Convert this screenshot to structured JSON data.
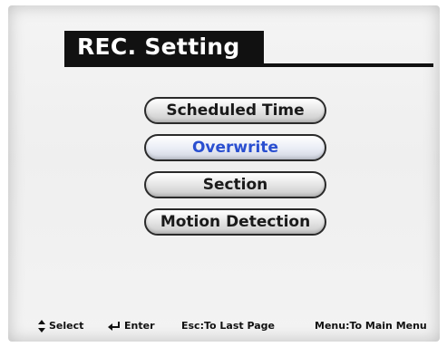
{
  "header": {
    "title": "REC. Setting"
  },
  "menu": {
    "items": [
      {
        "label": "Scheduled Time"
      },
      {
        "label": "Overwrite"
      },
      {
        "label": "Section"
      },
      {
        "label": "Motion Detection"
      }
    ],
    "selected_index": 1
  },
  "footer": {
    "select": {
      "icon": "up-down-arrows-icon",
      "label": "Select"
    },
    "enter": {
      "icon": "enter-return-icon",
      "label": "Enter"
    },
    "esc": {
      "label": "Esc:To Last Page"
    },
    "menu": {
      "label": "Menu:To Main Menu"
    }
  },
  "colors": {
    "selected_text": "#2a4fd0",
    "title_bg": "#111111",
    "title_text": "#ffffff"
  }
}
